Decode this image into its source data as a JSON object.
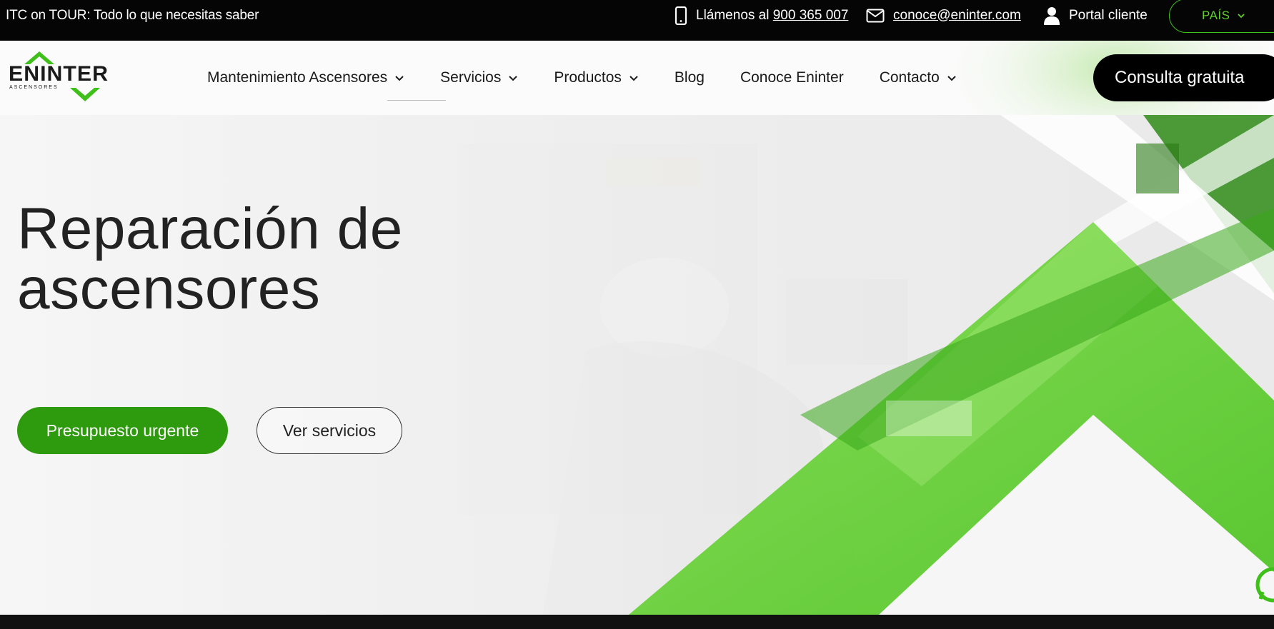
{
  "topbar": {
    "promo": "ITC on TOUR: Todo lo que necesitas saber",
    "phone_prefix": "Llámenos al",
    "phone_number": "900 365 007",
    "email": "conoce@eninter.com",
    "portal": "Portal cliente",
    "country": "PAÍS"
  },
  "brand": {
    "name": "ENINTER",
    "tagline": "ASCENSORES",
    "accent_color": "#3fbf1a"
  },
  "nav": {
    "items": [
      {
        "label": "Mantenimiento Ascensores",
        "has_dropdown": true
      },
      {
        "label": "Servicios",
        "has_dropdown": true
      },
      {
        "label": "Productos",
        "has_dropdown": true
      },
      {
        "label": "Blog",
        "has_dropdown": false
      },
      {
        "label": "Conoce Eninter",
        "has_dropdown": false
      },
      {
        "label": "Contacto",
        "has_dropdown": true
      }
    ],
    "cta": "Consulta gratuita"
  },
  "hero": {
    "title_line1": "Reparación de",
    "title_line2": "ascensores",
    "primary_button": "Presupuesto urgente",
    "secondary_button": "Ver servicios",
    "primary_color": "#2e9a0d"
  },
  "icons": [
    "phone-icon",
    "mail-icon",
    "user-icon",
    "chevron-down-icon",
    "whatsapp-icon"
  ]
}
